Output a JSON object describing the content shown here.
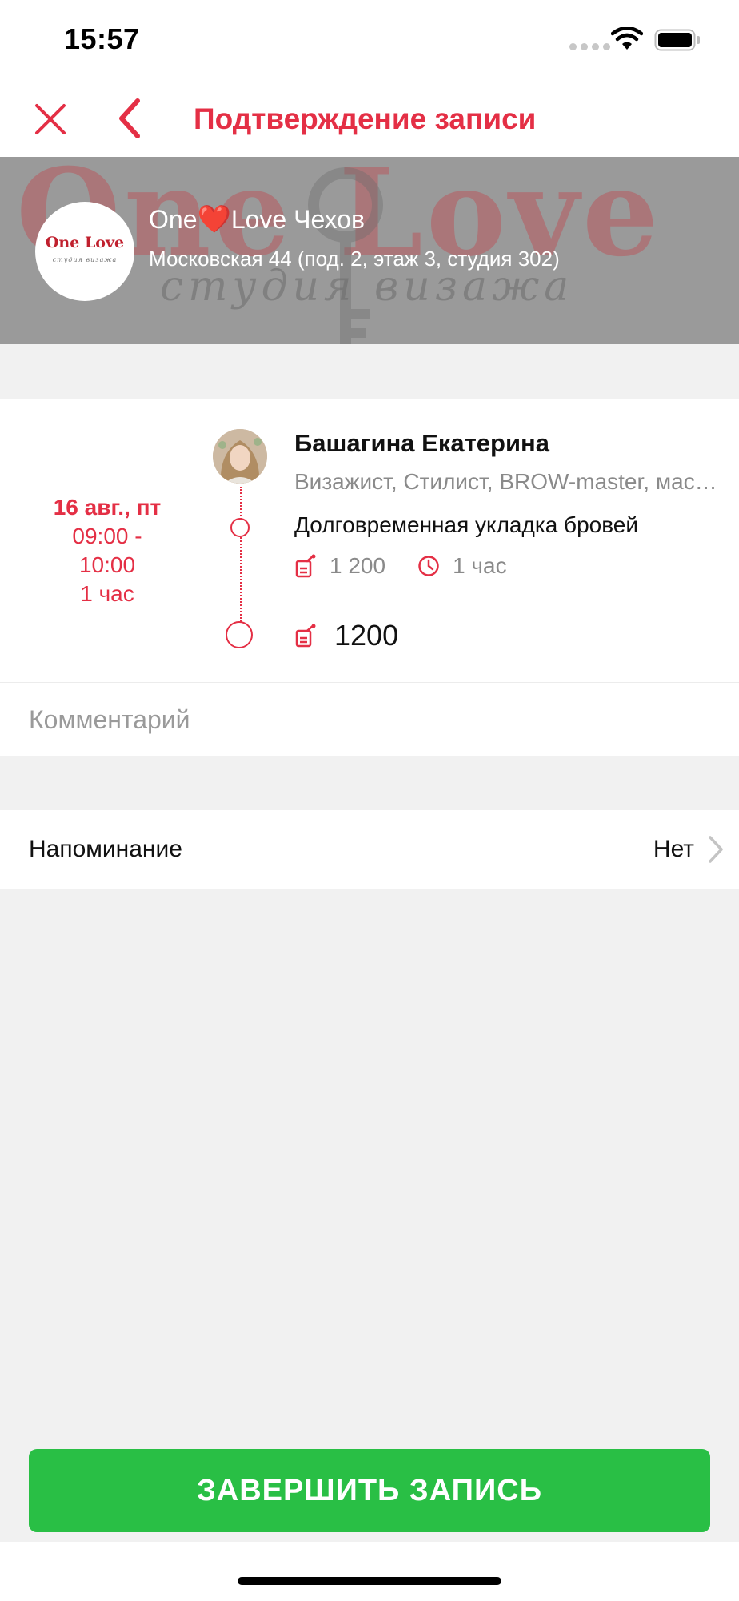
{
  "status_bar": {
    "time": "15:57"
  },
  "nav": {
    "title": "Подтверждение записи"
  },
  "salon": {
    "name_before": "One",
    "name_heart": "❤️",
    "name_after": "Love Чехов",
    "address": "Московская 44 (под. 2, этаж 3, студия 302)",
    "banner_text": "One Love",
    "banner_sub": "студия визажа",
    "logo_text": "One Love",
    "logo_sub": "студия визажа"
  },
  "appointment": {
    "date": "16 авг., пт",
    "time_start": "09:00 -",
    "time_end": "10:00",
    "duration": "1 час",
    "master_name": "Башагина Екатерина",
    "master_roles": "Визажист, Стилист, BROW-master, мастер по наращиванию ресниц",
    "service_name": "Долговременная укладка бровей",
    "service_price": "1 200",
    "service_duration": "1 час",
    "total": "1200"
  },
  "comment": {
    "placeholder": "Комментарий"
  },
  "reminder": {
    "label": "Напоминание",
    "value": "Нет"
  },
  "finish_button": {
    "label": "ЗАВЕРШИТЬ ЗАПИСЬ"
  },
  "colors": {
    "accent": "#e42f45",
    "button": "#29bf45",
    "background": "#f1f1f1"
  },
  "icons": {
    "close": "close-icon",
    "back": "back-chevron-icon",
    "price": "price-tag-icon",
    "clock": "clock-icon",
    "chevron": "chevron-right-icon"
  }
}
